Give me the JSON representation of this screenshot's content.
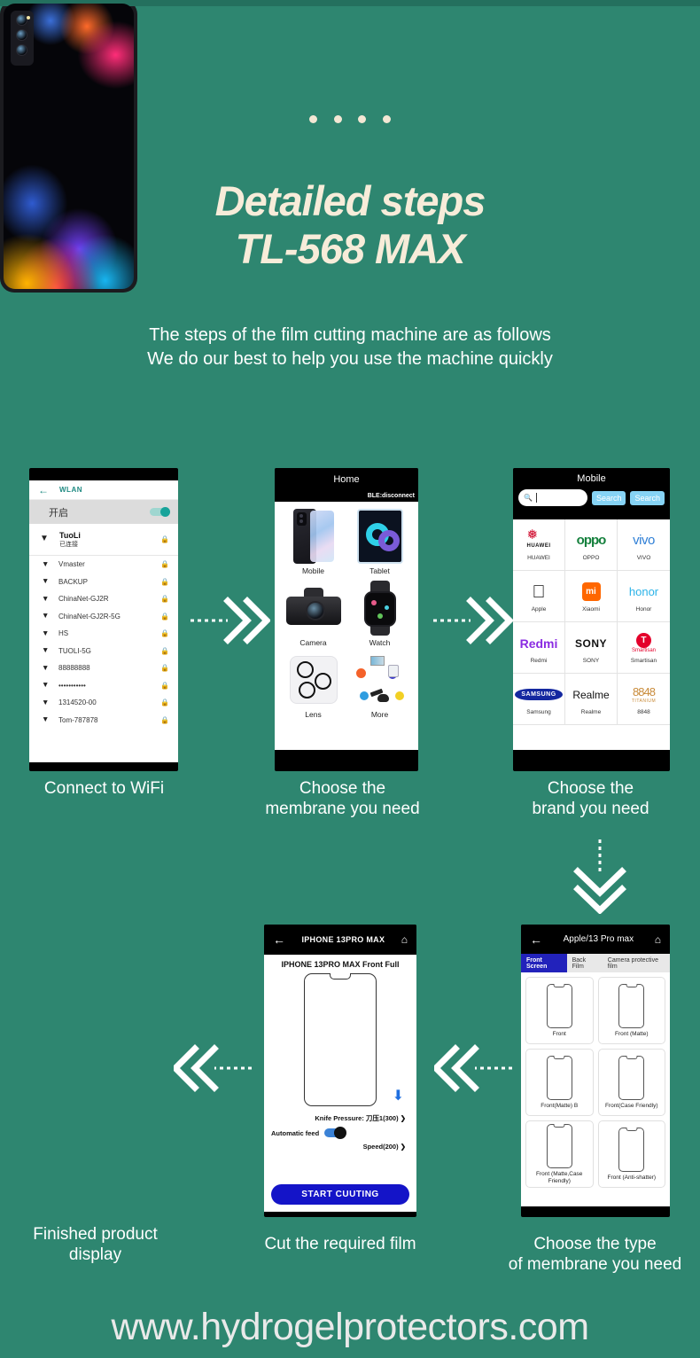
{
  "theme": {
    "background": "#2e8670",
    "title_color": "#f7ecd9",
    "accent_blue": "#1414c8"
  },
  "header": {
    "title_line1": "Detailed steps",
    "title_line2": "TL-568 MAX",
    "subtitle_line1": "The steps of the film cutting machine are as follows",
    "subtitle_line2": "We do our best to help you use the machine quickly"
  },
  "steps": [
    {
      "caption_line1": "Connect to WiFi",
      "caption_line2": ""
    },
    {
      "caption_line1": "Choose the",
      "caption_line2": "membrane you need"
    },
    {
      "caption_line1": "Choose the",
      "caption_line2": "brand you need"
    },
    {
      "caption_line1": "Choose the type",
      "caption_line2": "of membrane you need"
    },
    {
      "caption_line1": "Cut the required film",
      "caption_line2": ""
    },
    {
      "caption_line1": "Finished product",
      "caption_line2": "display"
    }
  ],
  "wifi_screen": {
    "back_icon": "back-arrow-icon",
    "title": "WLAN",
    "toggle_label": "开启",
    "connected": {
      "name": "TuoLi",
      "status": "已连接",
      "lock_icon": "lock-icon"
    },
    "networks": [
      "Vmaster",
      "BACKUP",
      "ChinaNet-GJ2R",
      "ChinaNet-GJ2R-5G",
      "HS",
      "TUOLI-5G",
      "88888888",
      "•••••••••••",
      "1314520-00",
      "Tom-787878"
    ]
  },
  "home_screen": {
    "title": "Home",
    "ble_status": "BLE:disconnect",
    "categories": [
      {
        "label": "Mobile"
      },
      {
        "label": "Tablet"
      },
      {
        "label": "Camera"
      },
      {
        "label": "Watch"
      },
      {
        "label": "Lens"
      },
      {
        "label": "More"
      }
    ]
  },
  "brand_screen": {
    "title": "Mobile",
    "search_placeholder": "",
    "search_value": "",
    "search_button_1": "Search",
    "search_button_2": "Search",
    "brands": [
      {
        "name": "HUAWEI",
        "logo_text": "HUAWEI"
      },
      {
        "name": "OPPO",
        "logo_text": "oppo"
      },
      {
        "name": "VIVO",
        "logo_text": "vivo"
      },
      {
        "name": "Apple",
        "logo_text": ""
      },
      {
        "name": "Xiaomi",
        "logo_text": "mi"
      },
      {
        "name": "Honor",
        "logo_text": "honor"
      },
      {
        "name": "Redmi",
        "logo_text": "Redmi"
      },
      {
        "name": "SONY",
        "logo_text": "SONY"
      },
      {
        "name": "Smartisan",
        "logo_text": "Smartisan"
      },
      {
        "name": "Samsung",
        "logo_text": "SAMSUNG"
      },
      {
        "name": "Realme",
        "logo_text": "Realme"
      },
      {
        "name": "8848",
        "logo_text": "8848",
        "logo_sub": "TITANIUM"
      }
    ]
  },
  "membrane_screen": {
    "back_icon": "back-arrow-icon",
    "title": "Apple/13 Pro max",
    "home_icon": "home-icon",
    "tabs": [
      {
        "label": "Front Screen",
        "active": true
      },
      {
        "label": "Back Film",
        "active": false
      },
      {
        "label": "Camera protective film",
        "active": false
      }
    ],
    "types": [
      "Front",
      "Front (Matte)",
      "Front(Matte) B",
      "Front(Case Friendly)",
      "Front (Matte,Case Friendly)",
      "Front (Anti-shatter)"
    ]
  },
  "cutting_screen": {
    "back_icon": "back-arrow-icon",
    "title": "IPHONE 13PRO MAX",
    "home_icon": "home-icon",
    "film_title": "IPHONE 13PRO MAX Front Full",
    "download_icon": "download-icon",
    "knife_pressure_label": "Knife Pressure:",
    "knife_pressure_value": "刀压1(300)",
    "automatic_feed_label": "Automatic feed",
    "automatic_feed_on": true,
    "speed_label": "Speed(200)",
    "start_button": "START CUUTING"
  },
  "footer": {
    "url": "www.hydrogelprotectors.com"
  }
}
